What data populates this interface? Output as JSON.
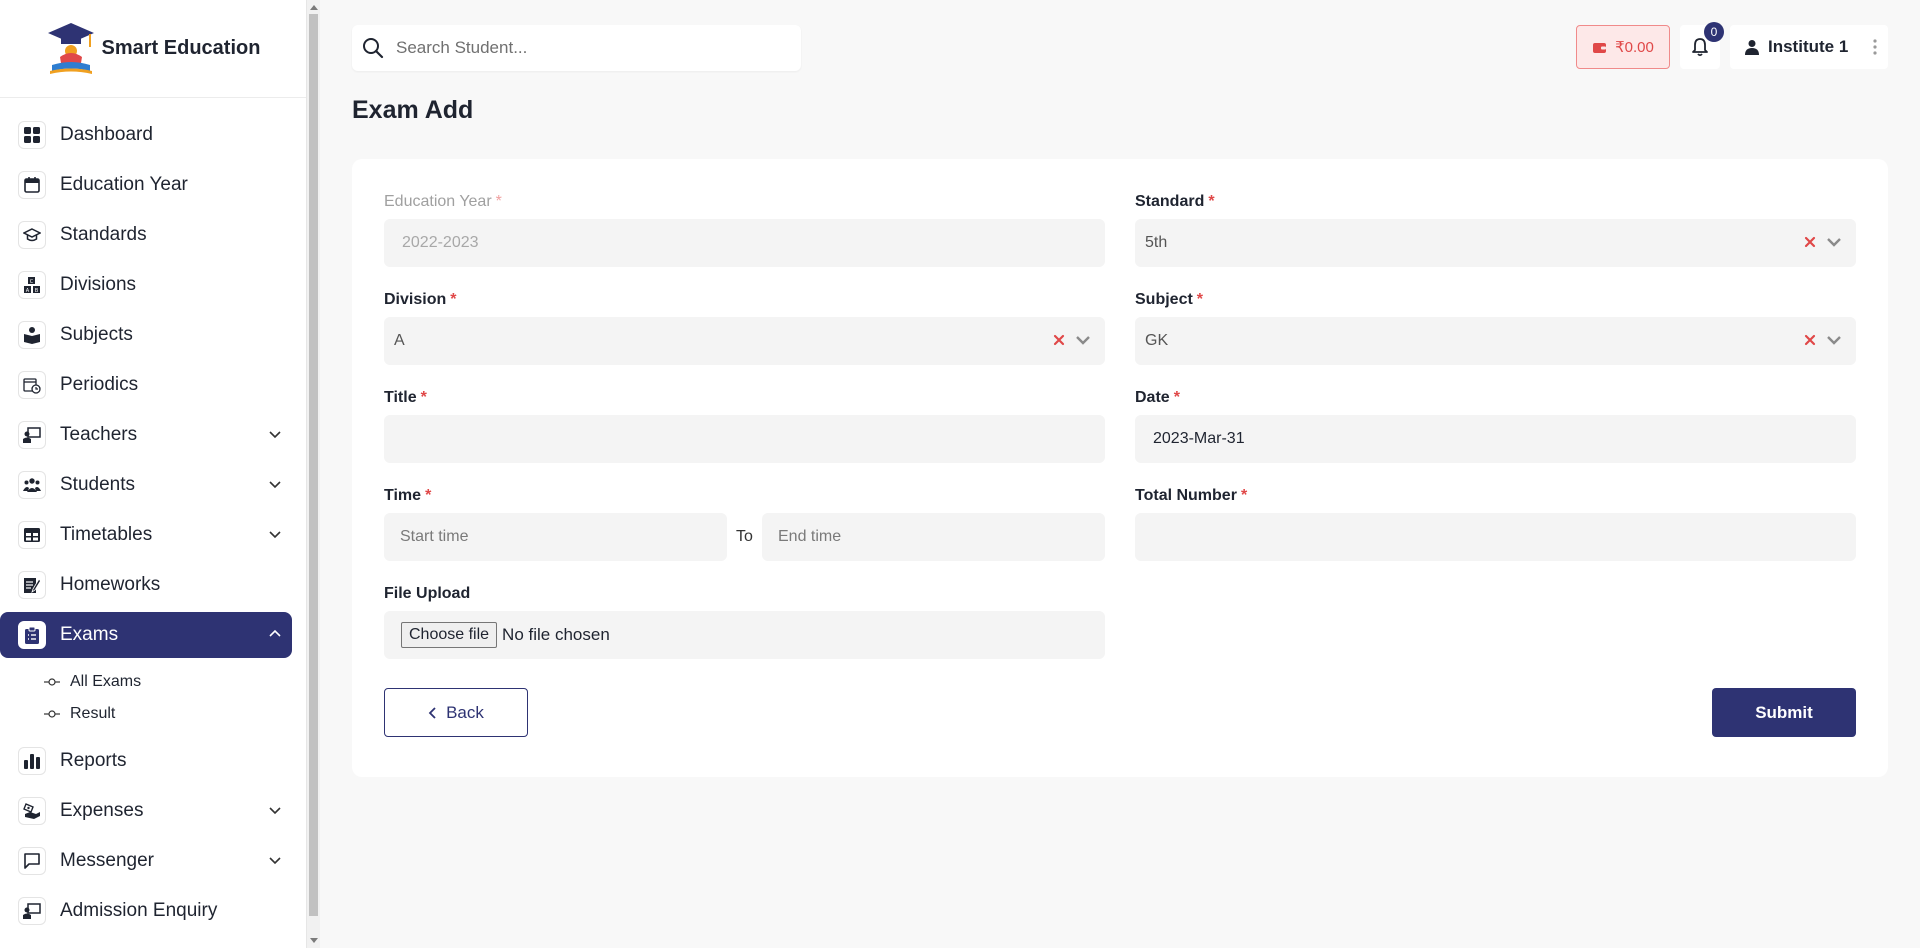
{
  "brand": {
    "name": "Smart Education"
  },
  "search": {
    "placeholder": "Search Student..."
  },
  "header": {
    "wallet_amount": "₹0.00",
    "notification_count": "0",
    "user_name": "Institute 1"
  },
  "sidebar": {
    "items": [
      {
        "label": "Dashboard",
        "icon": "grid-icon"
      },
      {
        "label": "Education Year",
        "icon": "calendar-icon"
      },
      {
        "label": "Standards",
        "icon": "graduation-cap-icon"
      },
      {
        "label": "Divisions",
        "icon": "abc-blocks-icon"
      },
      {
        "label": "Subjects",
        "icon": "reading-icon"
      },
      {
        "label": "Periodics",
        "icon": "calendar-clock-icon"
      },
      {
        "label": "Teachers",
        "icon": "teacher-board-icon"
      },
      {
        "label": "Students",
        "icon": "students-icon"
      },
      {
        "label": "Timetables",
        "icon": "table-icon"
      },
      {
        "label": "Homeworks",
        "icon": "notepad-icon"
      },
      {
        "label": "Exams",
        "icon": "clipboard-icon"
      },
      {
        "label": "Reports",
        "icon": "bar-chart-icon"
      },
      {
        "label": "Expenses",
        "icon": "hand-money-icon"
      },
      {
        "label": "Messenger",
        "icon": "message-icon"
      },
      {
        "label": "Admission Enquiry",
        "icon": "enquiry-board-icon"
      }
    ],
    "exams_sub": [
      {
        "label": "All Exams"
      },
      {
        "label": "Result"
      }
    ]
  },
  "page": {
    "title": "Exam Add"
  },
  "form": {
    "education_year": {
      "label": "Education Year",
      "value": "2022-2023"
    },
    "standard": {
      "label": "Standard",
      "value": "5th"
    },
    "division": {
      "label": "Division",
      "value": "A"
    },
    "subject": {
      "label": "Subject",
      "value": "GK"
    },
    "title": {
      "label": "Title",
      "value": ""
    },
    "date": {
      "label": "Date",
      "value": "2023-Mar-31"
    },
    "time": {
      "label": "Time",
      "start_placeholder": "Start time",
      "separator": "To",
      "end_placeholder": "End time"
    },
    "total_number": {
      "label": "Total Number",
      "value": ""
    },
    "file_upload": {
      "label": "File Upload",
      "button": "Choose file",
      "status": "No file chosen"
    },
    "back_label": "Back",
    "submit_label": "Submit"
  },
  "colors": {
    "primary": "#2e3373",
    "danger": "#e04848",
    "wallet_bg": "#fde8e8"
  }
}
